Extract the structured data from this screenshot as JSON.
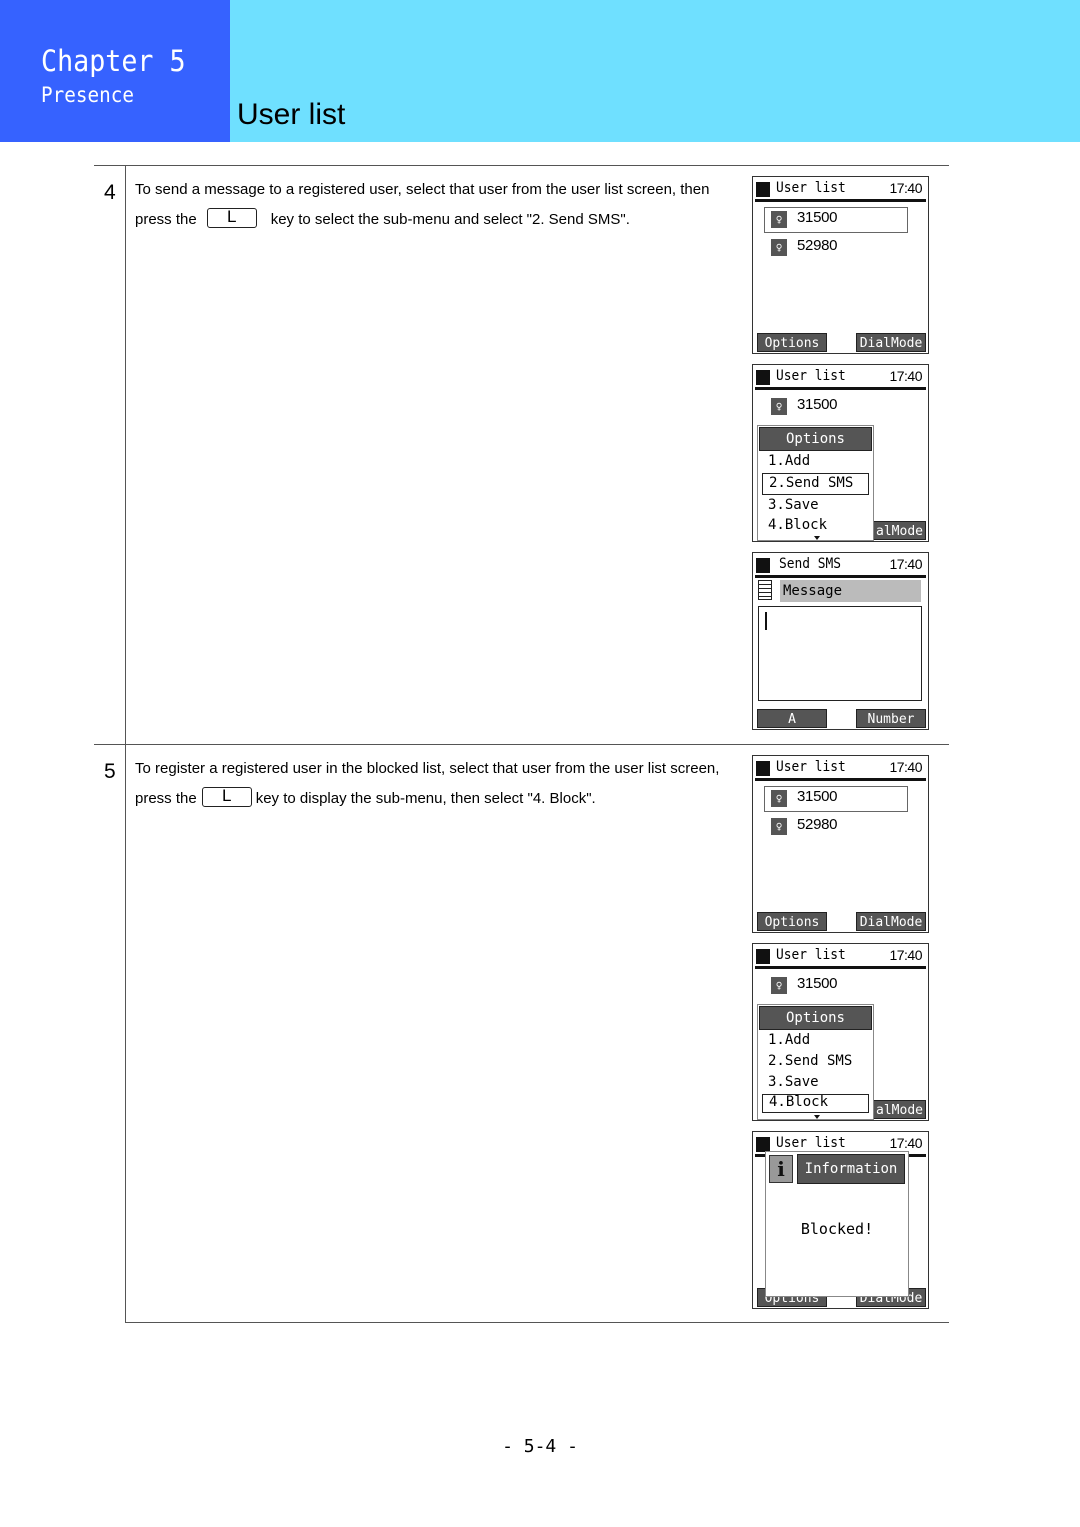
{
  "header": {
    "chapter": "Chapter 5",
    "section": "Presence",
    "title": "User list"
  },
  "colors": {
    "chapter_block": "#3662ff",
    "title_band": "#6fe0ff"
  },
  "steps": [
    {
      "number": "4",
      "text_before_key": "To send a message to a registered user, select that user from the user list screen, then press the",
      "key": "L",
      "text_after_key": "key to select the sub-menu and select \"2. Send SMS\".",
      "screens": [
        {
          "title": "User list",
          "time": "17:40",
          "rows": [
            {
              "icon": "bulb-icon",
              "number": "31500",
              "selected": true
            },
            {
              "icon": "bulb-icon",
              "number": "52980",
              "selected": false
            }
          ],
          "soft_left": "Options",
          "soft_right": "DialMode"
        },
        {
          "title": "User list",
          "time": "17:40",
          "rows": [
            {
              "icon": "bulb-icon",
              "number": "31500"
            }
          ],
          "menu": {
            "title": "Options",
            "items": [
              "1.Add",
              "2.Send SMS",
              "3.Save",
              "4.Block"
            ],
            "selected_index": 1
          },
          "soft_right_partial": "alMode"
        },
        {
          "title": "Send SMS",
          "time": "17:40",
          "field_label": "Message",
          "soft_left": "A",
          "soft_right": "Number"
        }
      ]
    },
    {
      "number": "5",
      "text_before_key": "To register a registered user in the blocked list, select that user from the user list screen, press the",
      "key": "L",
      "text_after_key": "key to display the sub-menu, then select \"4. Block\".",
      "screens": [
        {
          "title": "User list",
          "time": "17:40",
          "rows": [
            {
              "icon": "bulb-icon",
              "number": "31500",
              "selected": true
            },
            {
              "icon": "bulb-icon",
              "number": "52980",
              "selected": false
            }
          ],
          "soft_left": "Options",
          "soft_right": "DialMode"
        },
        {
          "title": "User list",
          "time": "17:40",
          "rows": [
            {
              "icon": "bulb-icon",
              "number": "31500"
            }
          ],
          "menu": {
            "title": "Options",
            "items": [
              "1.Add",
              "2.Send SMS",
              "3.Save",
              "4.Block"
            ],
            "selected_index": 3
          },
          "soft_right_partial": "alMode"
        },
        {
          "title": "User list",
          "time": "17:40",
          "popup": {
            "icon": "info-icon",
            "title": "Information",
            "message": "Blocked!"
          },
          "soft_left": "Options",
          "soft_right": "DialMode"
        }
      ]
    }
  ],
  "footer": {
    "page_number": "- 5-4 -"
  }
}
